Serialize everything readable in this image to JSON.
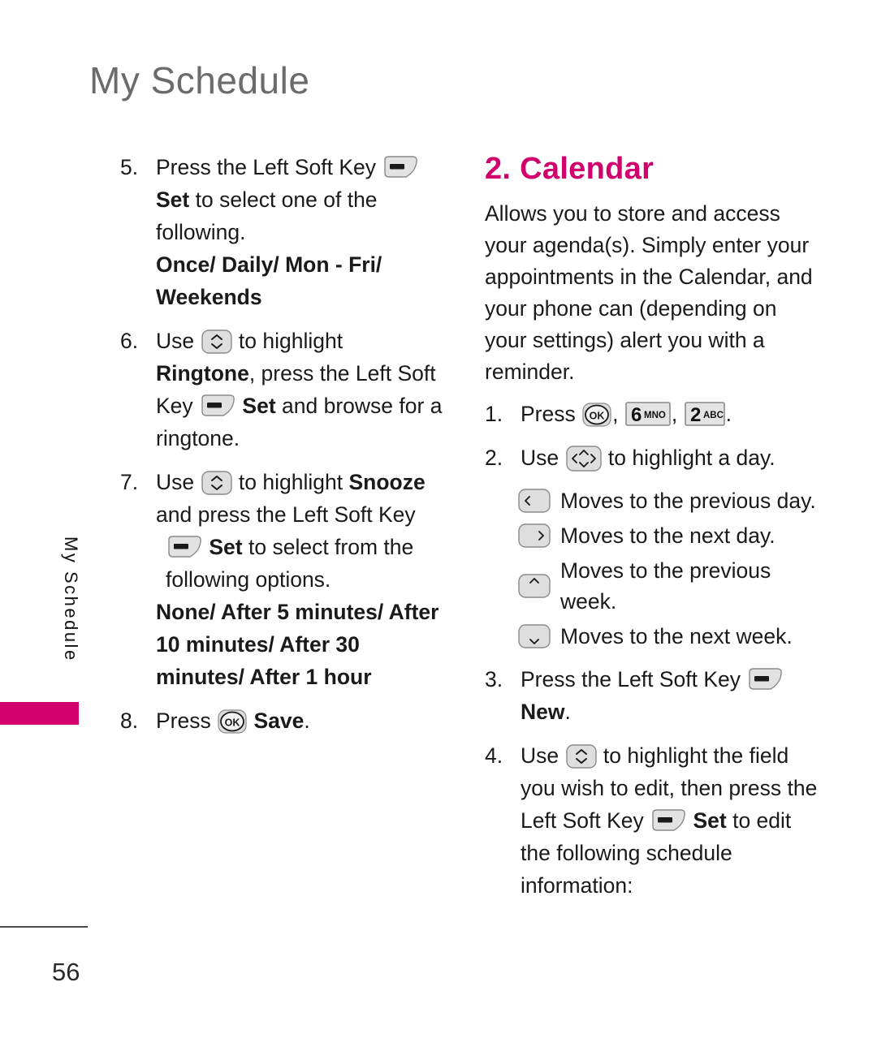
{
  "page": {
    "title": "My Schedule",
    "side_tab_label": "My Schedule",
    "page_number": "56",
    "accent_color": "#d1006c",
    "title_color": "#6b6b6b"
  },
  "left_column": {
    "steps": [
      {
        "number": "5.",
        "line1_pre": "Press the Left Soft Key",
        "icon1": "left-soft-key-icon",
        "line2_bold": "Set",
        "line2_rest": " to select one of the following.",
        "line3_bold": "Once/ Daily/ Mon - Fri/ Weekends"
      },
      {
        "number": "6.",
        "line1_pre": "Use",
        "icon1": "up-down-nav-key-icon",
        "line1_post": "to highlight",
        "line2_bold": "Ringtone",
        "line2_mid": ", press the Left Soft Key",
        "icon2": "left-soft-key-icon",
        "line2_bold2": "Set",
        "line2_rest": " and browse for a ringtone."
      },
      {
        "number": "7.",
        "line1_pre": "Use",
        "icon1": "up-down-nav-key-icon",
        "line1_post": "to highlight",
        "line1_bold": "Snooze",
        "line2": "and press the Left Soft Key",
        "icon2": "left-soft-key-icon",
        "line3_bold": "Set",
        "line3_rest": " to select from the following options.",
        "line4_bold": "None/ After 5 minutes/ After 10 minutes/ After 30 minutes/ After 1 hour"
      },
      {
        "number": "8.",
        "line1_pre": "Press",
        "icon1": "ok-key-icon",
        "line1_bold": "Save",
        "line1_post": "."
      }
    ]
  },
  "right_column": {
    "heading": "2. Calendar",
    "intro": "Allows you to store and access your agenda(s). Simply enter your appointments in the Calendar, and your phone can (depending on your settings) alert you with a reminder.",
    "steps": [
      {
        "number": "1.",
        "line1_pre": "Press",
        "icon1": "ok-key-icon",
        "sep1": ",",
        "icon2": "digit-key-6-mno-icon",
        "key2_digit": "6",
        "key2_letters": "MNO",
        "sep2": ",",
        "icon3": "digit-key-2-abc-icon",
        "key3_digit": "2",
        "key3_letters": "ABC",
        "end": "."
      },
      {
        "number": "2.",
        "line1_pre": "Use",
        "icon1": "four-way-nav-key-icon",
        "line1_post": "to highlight a day."
      },
      {
        "number": "3.",
        "line1_pre": "Press the Left Soft Key",
        "icon1": "left-soft-key-icon",
        "line2_bold": "New",
        "line2_post": "."
      },
      {
        "number": "4.",
        "line1_pre": "Use",
        "icon1": "up-down-nav-key-icon",
        "line1_post": "to highlight the field you wish to edit, then press the Left Soft Key",
        "icon2": "left-soft-key-icon",
        "line2_bold": "Set",
        "line2_rest": " to edit the following schedule information:"
      }
    ],
    "key_descriptions": [
      {
        "icon": "left-arrow-key-icon",
        "text": "Moves to the previous day."
      },
      {
        "icon": "right-arrow-key-icon",
        "text": "Moves to the next day."
      },
      {
        "icon": "up-arrow-key-icon",
        "text": "Moves to the previous week."
      },
      {
        "icon": "down-arrow-key-icon",
        "text": "Moves to the next week."
      }
    ]
  }
}
